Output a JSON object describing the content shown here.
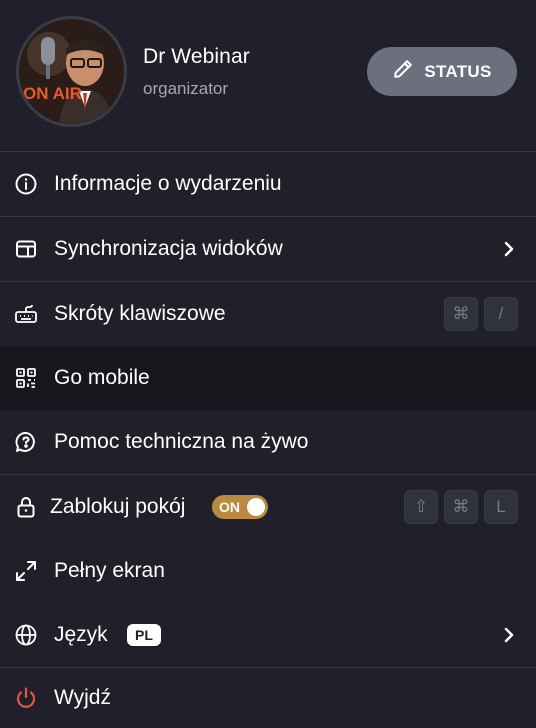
{
  "user": {
    "name": "Dr Webinar",
    "role": "organizator",
    "avatar_sign": "ON AIR"
  },
  "status_button": {
    "label": "STATUS",
    "icon": "pencil-icon"
  },
  "menu": {
    "items": [
      {
        "label": "Informacje o wydarzeniu",
        "icon": "info-icon"
      },
      {
        "label": "Synchronizacja widoków",
        "icon": "layout-sync-icon",
        "has_submenu": true
      },
      {
        "label": "Skróty klawiszowe",
        "icon": "keyboard-icon",
        "shortcut": [
          "⌘",
          "/"
        ]
      },
      {
        "label": "Go mobile",
        "icon": "qr-code-icon",
        "highlighted": true
      },
      {
        "label": "Pomoc techniczna na żywo",
        "icon": "support-chat-icon"
      },
      {
        "label": "Zablokuj pokój",
        "icon": "lock-icon",
        "toggle": "ON",
        "toggle_state": true,
        "shortcut": [
          "⇧",
          "⌘",
          "L"
        ]
      },
      {
        "label": "Pełny ekran",
        "icon": "fullscreen-icon"
      },
      {
        "label": "Język",
        "icon": "globe-icon",
        "badge": "PL",
        "has_submenu": true
      },
      {
        "label": "Wyjdź",
        "icon": "power-icon"
      }
    ]
  },
  "colors": {
    "background": "#1f2029",
    "highlight_row": "#17181e",
    "divider": "#353743",
    "status_button": "#6c6f7e",
    "toggle_on": "#b8893e",
    "exit_icon": "#e5534b",
    "muted_text": "#a7a9b5"
  }
}
